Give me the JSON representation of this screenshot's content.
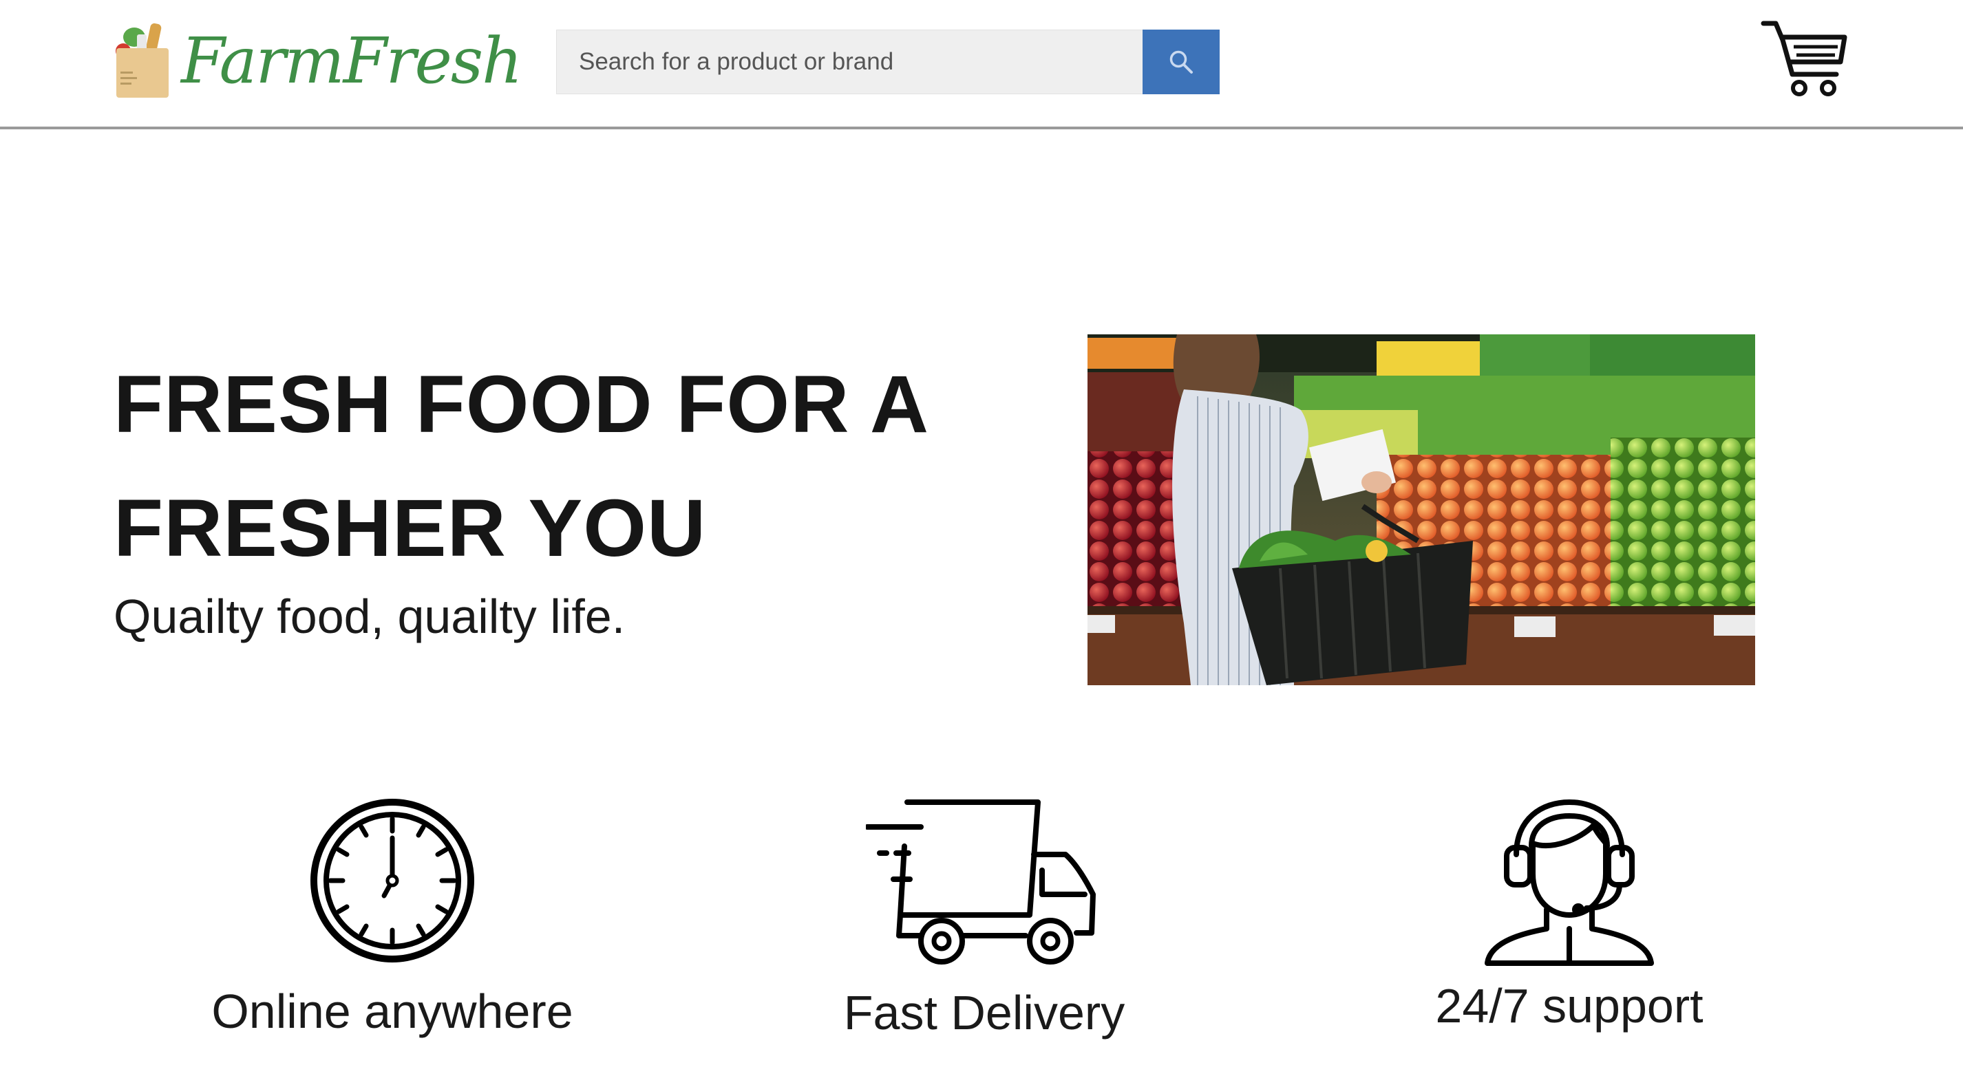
{
  "header": {
    "logo_text": "FarmFresh",
    "search": {
      "placeholder": "Search for a product or brand",
      "button_icon": "search-icon"
    },
    "cart_icon": "cart-icon"
  },
  "hero": {
    "title": "FRESH FOOD FOR A FRESHER YOU",
    "subtitle": "Quailty food, quailty life.",
    "image": "woman-shopping-produce-photo"
  },
  "features": [
    {
      "icon": "clock-icon",
      "label": "Online anywhere"
    },
    {
      "icon": "delivery-truck-icon",
      "label": "Fast Delivery"
    },
    {
      "icon": "support-agent-icon",
      "label": "24/7 support"
    }
  ],
  "colors": {
    "brand_green": "#3f8f47",
    "search_button": "#3d73b9",
    "header_border": "#9a9a9a"
  }
}
